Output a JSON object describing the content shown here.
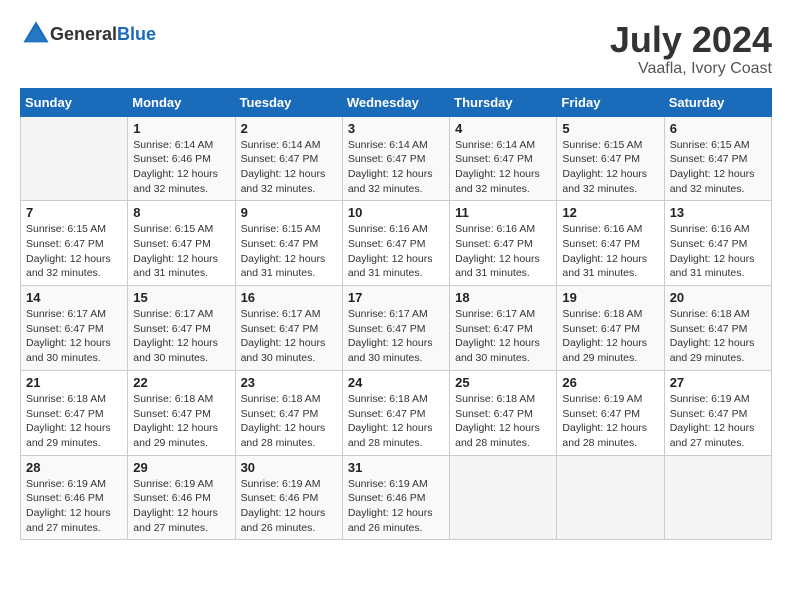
{
  "header": {
    "logo": {
      "general": "General",
      "blue": "Blue"
    },
    "title": "July 2024",
    "location": "Vaafla, Ivory Coast"
  },
  "calendar": {
    "days_of_week": [
      "Sunday",
      "Monday",
      "Tuesday",
      "Wednesday",
      "Thursday",
      "Friday",
      "Saturday"
    ],
    "weeks": [
      [
        {
          "day": "",
          "info": ""
        },
        {
          "day": "1",
          "info": "Sunrise: 6:14 AM\nSunset: 6:46 PM\nDaylight: 12 hours\nand 32 minutes."
        },
        {
          "day": "2",
          "info": "Sunrise: 6:14 AM\nSunset: 6:47 PM\nDaylight: 12 hours\nand 32 minutes."
        },
        {
          "day": "3",
          "info": "Sunrise: 6:14 AM\nSunset: 6:47 PM\nDaylight: 12 hours\nand 32 minutes."
        },
        {
          "day": "4",
          "info": "Sunrise: 6:14 AM\nSunset: 6:47 PM\nDaylight: 12 hours\nand 32 minutes."
        },
        {
          "day": "5",
          "info": "Sunrise: 6:15 AM\nSunset: 6:47 PM\nDaylight: 12 hours\nand 32 minutes."
        },
        {
          "day": "6",
          "info": "Sunrise: 6:15 AM\nSunset: 6:47 PM\nDaylight: 12 hours\nand 32 minutes."
        }
      ],
      [
        {
          "day": "7",
          "info": "Sunrise: 6:15 AM\nSunset: 6:47 PM\nDaylight: 12 hours\nand 32 minutes."
        },
        {
          "day": "8",
          "info": "Sunrise: 6:15 AM\nSunset: 6:47 PM\nDaylight: 12 hours\nand 31 minutes."
        },
        {
          "day": "9",
          "info": "Sunrise: 6:15 AM\nSunset: 6:47 PM\nDaylight: 12 hours\nand 31 minutes."
        },
        {
          "day": "10",
          "info": "Sunrise: 6:16 AM\nSunset: 6:47 PM\nDaylight: 12 hours\nand 31 minutes."
        },
        {
          "day": "11",
          "info": "Sunrise: 6:16 AM\nSunset: 6:47 PM\nDaylight: 12 hours\nand 31 minutes."
        },
        {
          "day": "12",
          "info": "Sunrise: 6:16 AM\nSunset: 6:47 PM\nDaylight: 12 hours\nand 31 minutes."
        },
        {
          "day": "13",
          "info": "Sunrise: 6:16 AM\nSunset: 6:47 PM\nDaylight: 12 hours\nand 31 minutes."
        }
      ],
      [
        {
          "day": "14",
          "info": "Sunrise: 6:17 AM\nSunset: 6:47 PM\nDaylight: 12 hours\nand 30 minutes."
        },
        {
          "day": "15",
          "info": "Sunrise: 6:17 AM\nSunset: 6:47 PM\nDaylight: 12 hours\nand 30 minutes."
        },
        {
          "day": "16",
          "info": "Sunrise: 6:17 AM\nSunset: 6:47 PM\nDaylight: 12 hours\nand 30 minutes."
        },
        {
          "day": "17",
          "info": "Sunrise: 6:17 AM\nSunset: 6:47 PM\nDaylight: 12 hours\nand 30 minutes."
        },
        {
          "day": "18",
          "info": "Sunrise: 6:17 AM\nSunset: 6:47 PM\nDaylight: 12 hours\nand 30 minutes."
        },
        {
          "day": "19",
          "info": "Sunrise: 6:18 AM\nSunset: 6:47 PM\nDaylight: 12 hours\nand 29 minutes."
        },
        {
          "day": "20",
          "info": "Sunrise: 6:18 AM\nSunset: 6:47 PM\nDaylight: 12 hours\nand 29 minutes."
        }
      ],
      [
        {
          "day": "21",
          "info": "Sunrise: 6:18 AM\nSunset: 6:47 PM\nDaylight: 12 hours\nand 29 minutes."
        },
        {
          "day": "22",
          "info": "Sunrise: 6:18 AM\nSunset: 6:47 PM\nDaylight: 12 hours\nand 29 minutes."
        },
        {
          "day": "23",
          "info": "Sunrise: 6:18 AM\nSunset: 6:47 PM\nDaylight: 12 hours\nand 28 minutes."
        },
        {
          "day": "24",
          "info": "Sunrise: 6:18 AM\nSunset: 6:47 PM\nDaylight: 12 hours\nand 28 minutes."
        },
        {
          "day": "25",
          "info": "Sunrise: 6:18 AM\nSunset: 6:47 PM\nDaylight: 12 hours\nand 28 minutes."
        },
        {
          "day": "26",
          "info": "Sunrise: 6:19 AM\nSunset: 6:47 PM\nDaylight: 12 hours\nand 28 minutes."
        },
        {
          "day": "27",
          "info": "Sunrise: 6:19 AM\nSunset: 6:47 PM\nDaylight: 12 hours\nand 27 minutes."
        }
      ],
      [
        {
          "day": "28",
          "info": "Sunrise: 6:19 AM\nSunset: 6:46 PM\nDaylight: 12 hours\nand 27 minutes."
        },
        {
          "day": "29",
          "info": "Sunrise: 6:19 AM\nSunset: 6:46 PM\nDaylight: 12 hours\nand 27 minutes."
        },
        {
          "day": "30",
          "info": "Sunrise: 6:19 AM\nSunset: 6:46 PM\nDaylight: 12 hours\nand 26 minutes."
        },
        {
          "day": "31",
          "info": "Sunrise: 6:19 AM\nSunset: 6:46 PM\nDaylight: 12 hours\nand 26 minutes."
        },
        {
          "day": "",
          "info": ""
        },
        {
          "day": "",
          "info": ""
        },
        {
          "day": "",
          "info": ""
        }
      ]
    ]
  }
}
